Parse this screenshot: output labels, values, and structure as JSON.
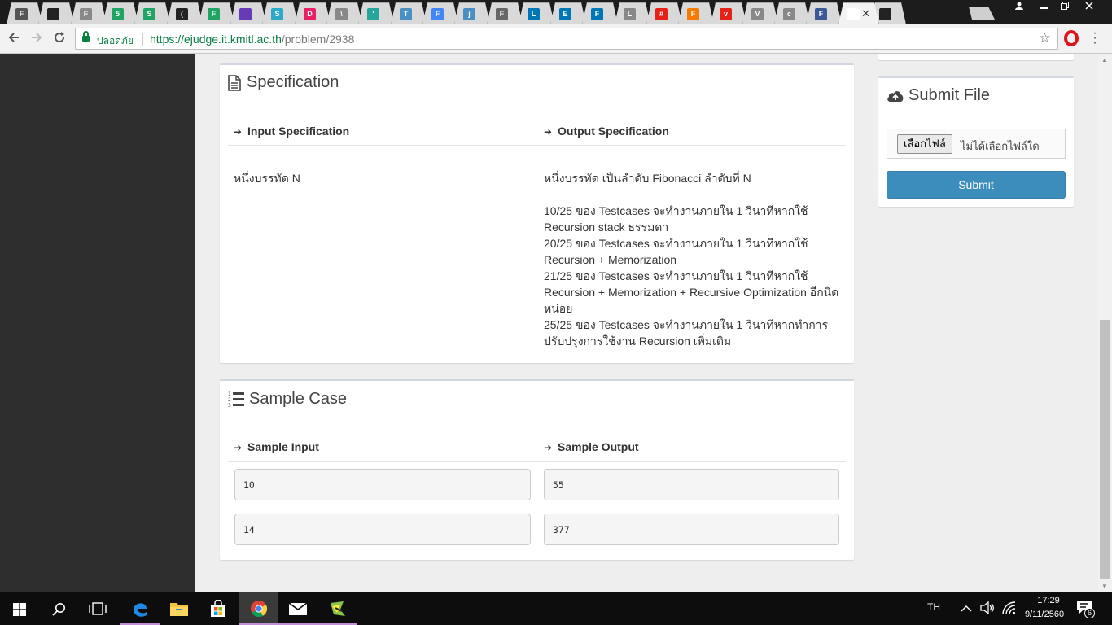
{
  "browser": {
    "tabs": [
      {
        "label": "F",
        "color": "#555"
      },
      {
        "label": "",
        "color": "#222"
      },
      {
        "label": "F",
        "color": "#888"
      },
      {
        "label": "5",
        "color": "#1fa463"
      },
      {
        "label": "S",
        "color": "#1fa463"
      },
      {
        "label": "(",
        "color": "#222"
      },
      {
        "label": "F",
        "color": "#1fa463"
      },
      {
        "label": "",
        "color": "#673ab7"
      },
      {
        "label": "S",
        "color": "#2aa9c9"
      },
      {
        "label": "D",
        "color": "#e91e63"
      },
      {
        "label": "\\",
        "color": "#888"
      },
      {
        "label": "'",
        "color": "#26a69a"
      },
      {
        "label": "T",
        "color": "#4a8fc4"
      },
      {
        "label": "F",
        "color": "#4285f4"
      },
      {
        "label": "j",
        "color": "#4a8fc4"
      },
      {
        "label": "F",
        "color": "#666"
      },
      {
        "label": "L",
        "color": "#0077b5"
      },
      {
        "label": "E",
        "color": "#0077b5"
      },
      {
        "label": "F",
        "color": "#0077b5"
      },
      {
        "label": "L",
        "color": "#888"
      },
      {
        "label": "#",
        "color": "#e62117"
      },
      {
        "label": "F",
        "color": "#f57c00"
      },
      {
        "label": "v",
        "color": "#e62117"
      },
      {
        "label": "V",
        "color": "#888"
      },
      {
        "label": "c",
        "color": "#888"
      },
      {
        "label": "F",
        "color": "#3b5998"
      },
      {
        "label": "‹",
        "color": "#fff"
      },
      {
        "label": "",
        "color": "#222"
      }
    ],
    "secure_label": "ปลอดภัย",
    "url_domain": "https://ejudge.it.kmitl.ac.th",
    "url_path": "/problem/2938"
  },
  "specification": {
    "title": "Specification",
    "input_heading": "Input Specification",
    "output_heading": "Output Specification",
    "input_text": "หนึ่งบรรทัด N",
    "output_lines": [
      "หนึ่งบรรทัด เป็นลำดับ Fibonacci ลำดับที่ N",
      "",
      "10/25 ของ Testcases จะทำงานภายใน 1 วินาทีหากใช้",
      "Recursion stack ธรรมดา",
      "20/25 ของ Testcases จะทำงานภายใน 1 วินาทีหากใช้",
      "Recursion + Memorization",
      "21/25 ของ Testcases จะทำงานภายใน 1 วินาทีหากใช้",
      "Recursion + Memorization + Recursive Optimization อีกนิด",
      "หน่อย",
      "25/25 ของ Testcases จะทำงานภายใน 1 วินาทีหากทำการ",
      "ปรับปรุงการใช้งาน Recursion เพิ่มเติม"
    ]
  },
  "sample": {
    "title": "Sample Case",
    "input_heading": "Sample Input",
    "output_heading": "Sample Output",
    "rows": [
      {
        "input": "10",
        "output": "55"
      },
      {
        "input": "14",
        "output": "377"
      }
    ]
  },
  "submit": {
    "title": "Submit File",
    "choose_file_label": "เลือกไฟล์",
    "no_file_label": "ไม่ได้เลือกไฟล์ใด",
    "submit_label": "Submit"
  },
  "taskbar": {
    "language": "TH",
    "time": "17:29",
    "date": "9/11/2560",
    "notification_count": "6"
  }
}
